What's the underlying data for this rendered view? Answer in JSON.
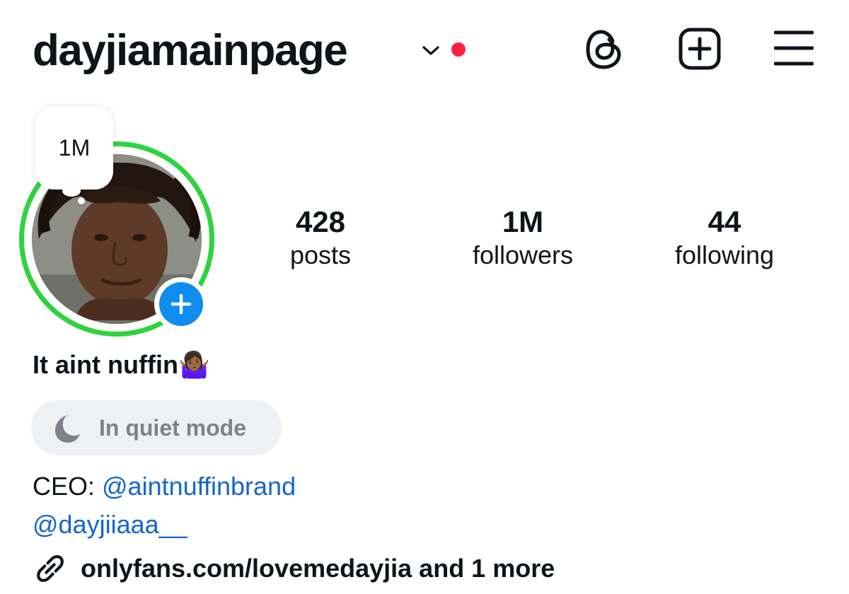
{
  "header": {
    "username": "dayjiamainpage",
    "icons": [
      "chevron-down-icon",
      "notification-dot",
      "threads-icon",
      "new-post-icon",
      "menu-icon"
    ],
    "dot_color": "#ff1f3d"
  },
  "profile": {
    "note": "1M",
    "ring_color": "#2ed33e",
    "add_story_color": "#0f8cf0"
  },
  "stats": [
    {
      "value": "428",
      "label": "posts"
    },
    {
      "value": "1M",
      "label": "followers"
    },
    {
      "value": "44",
      "label": "following"
    }
  ],
  "bio": {
    "name": "It aint nuffin",
    "name_emoji": "🤷🏾‍♀️",
    "quiet_mode": "In quiet mode",
    "ceo_prefix": "CEO: ",
    "ceo_link": "@aintnuffinbrand",
    "second_account": "@dayjiiaaa__",
    "external_link": "onlyfans.com/lovemedayjia and 1 more",
    "link_color": "#1566c9"
  }
}
